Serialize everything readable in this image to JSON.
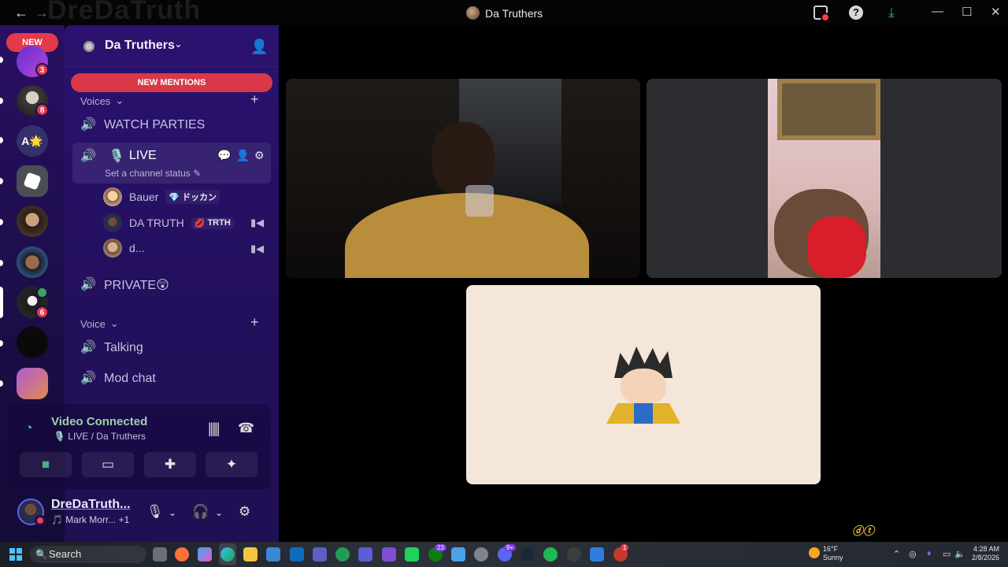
{
  "titlebar": {
    "back_icon": "←",
    "forward_icon": "→",
    "ghost_text": "DreDaTruth",
    "title": "Da Truthers",
    "help": "?",
    "download_icon": "⤓",
    "minimize": "—",
    "maximize": "☐",
    "close": "✕"
  },
  "servers": {
    "new_pill": "NEW",
    "badges": [
      "3",
      "8",
      "6"
    ],
    "letter_icon": "A🌟"
  },
  "guild": {
    "name": "Da Truthers",
    "chevron": "⌄"
  },
  "new_mentions": "NEW MENTIONS",
  "categories": {
    "voices": "Voices",
    "voice": "Voice",
    "chevron": "⌄",
    "plus": "+"
  },
  "channels": {
    "watch_parties": "WATCH PARTIES",
    "live": "LIVE",
    "live_status": "Set a channel status",
    "private": "PRIVATE😲",
    "talking": "Talking",
    "mod_chat": "Mod chat"
  },
  "members": [
    {
      "name": "Bauer",
      "tag": "ドッカン",
      "tag_icon": "💎",
      "camera": false
    },
    {
      "name": "DA TRUTH",
      "tag": "TRTH",
      "tag_icon": "💋",
      "camera": true
    },
    {
      "name": "d...",
      "tag": "",
      "tag_icon": "",
      "camera": true
    }
  ],
  "voice_panel": {
    "title": "Video Connected",
    "subtitle": "🎙️ LIVE / Da Truthers"
  },
  "user": {
    "name": "DreDaTruth...",
    "activity": "🎵 Mark Morr... +1"
  },
  "taskbar": {
    "search": "Search",
    "weather_temp": "16°F",
    "weather_desc": "Sunny",
    "time": "4:28 AM",
    "date": "2/8/2026",
    "badges": [
      "23",
      "9+",
      "1"
    ]
  },
  "colors": {
    "accent_green": "#43b581",
    "danger_red": "#e23a4b",
    "sidebar_purple": "#2b1270",
    "stage_bg": "#000000"
  }
}
